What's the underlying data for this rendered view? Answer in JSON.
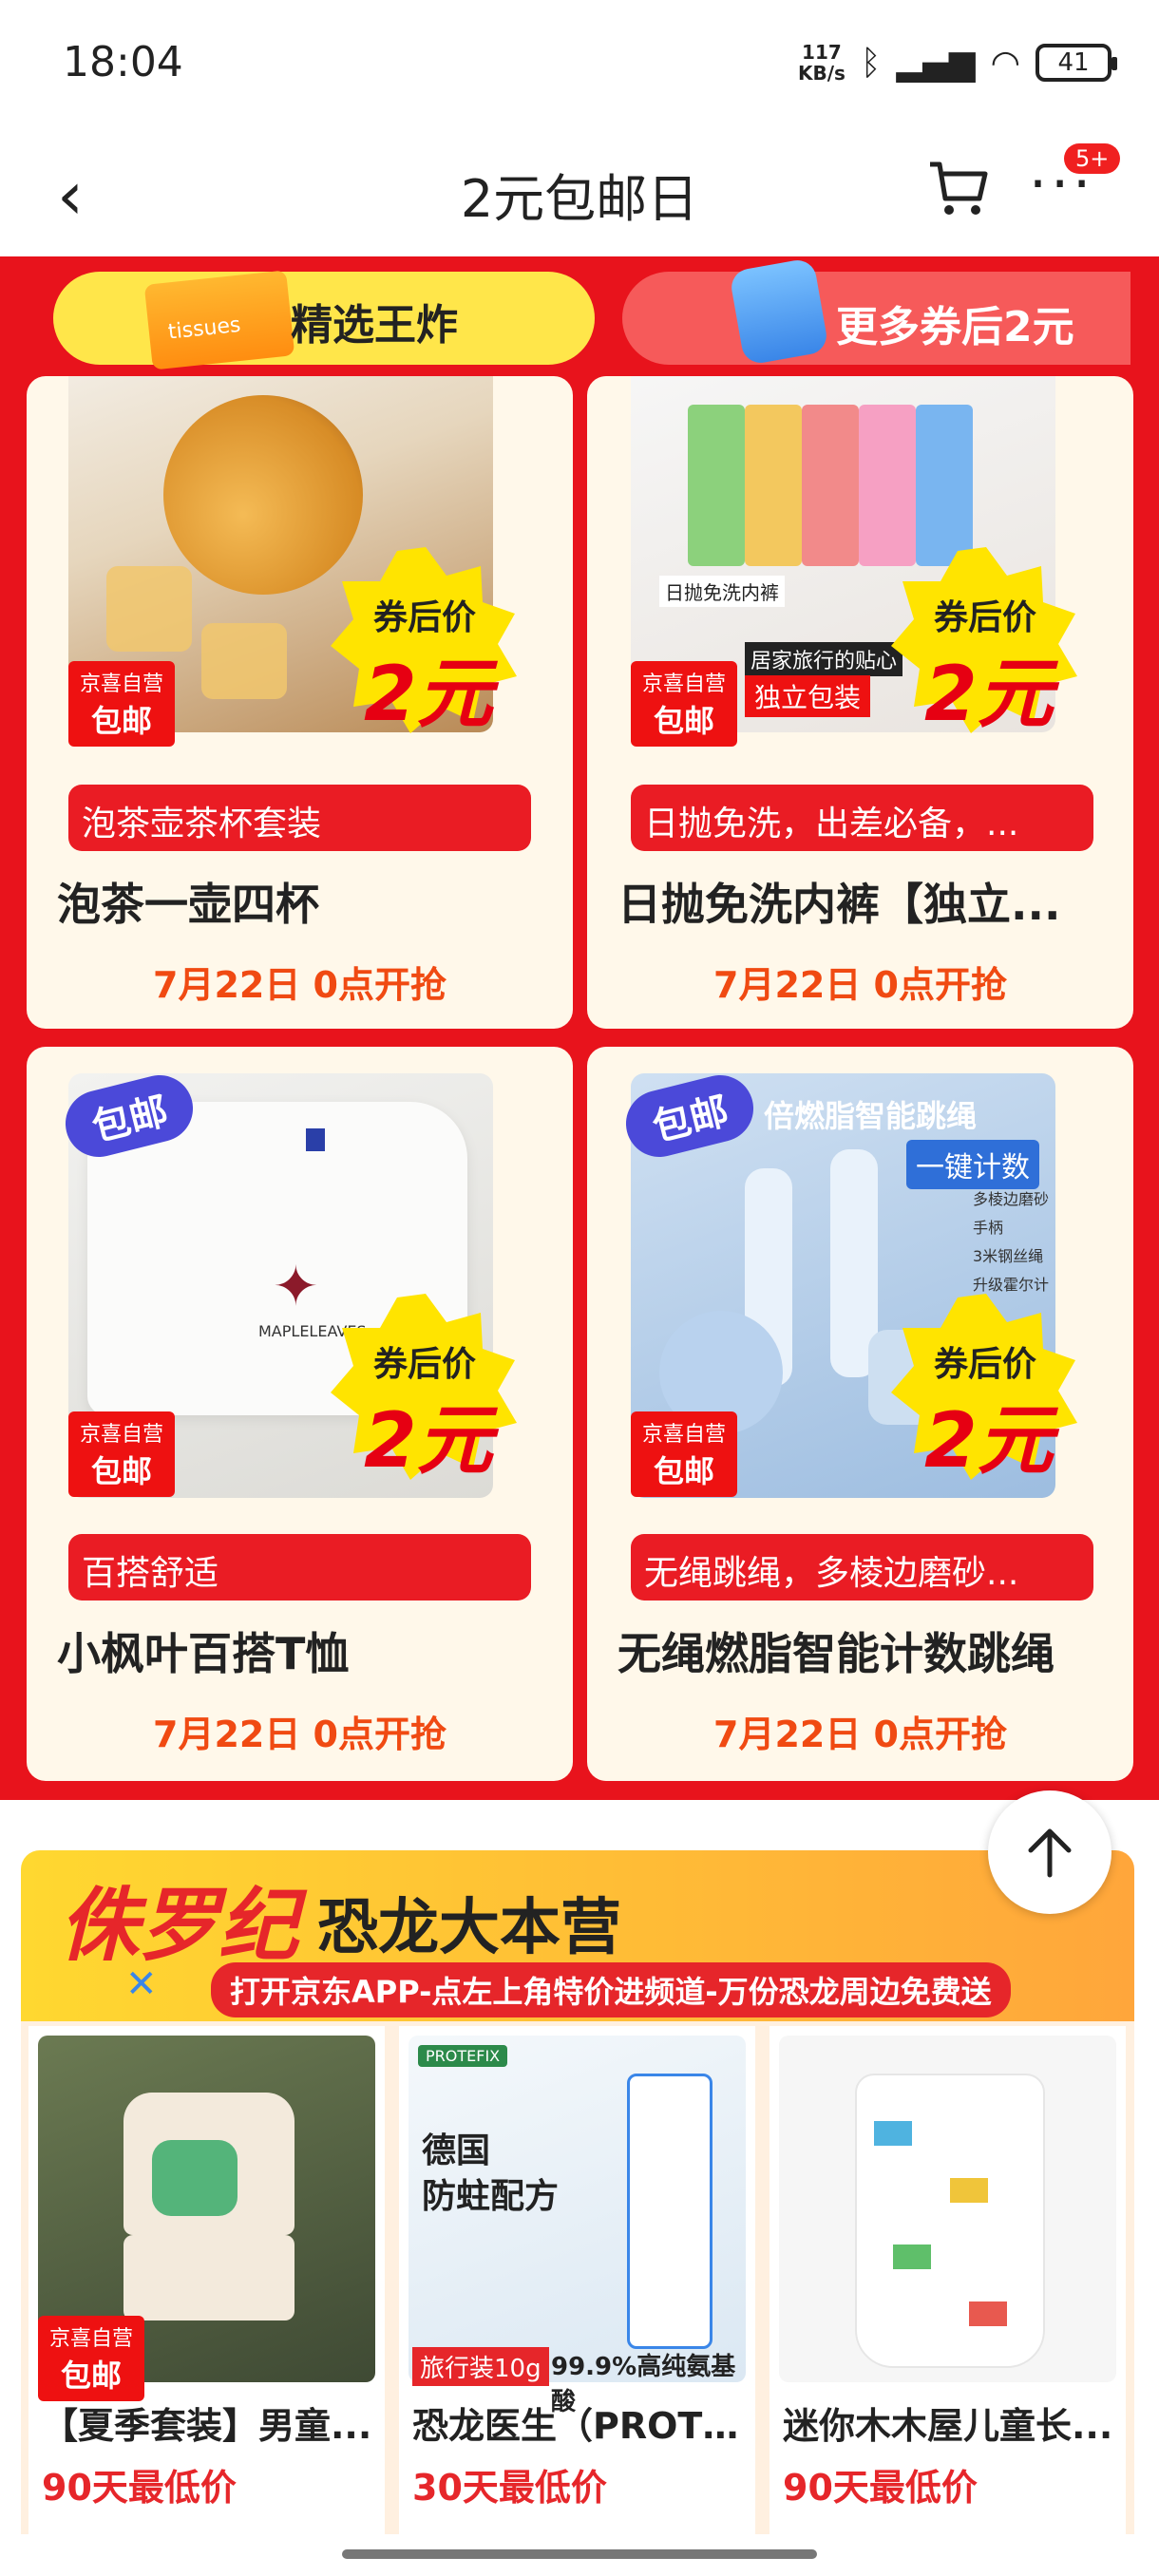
{
  "status": {
    "time": "18:04",
    "speed": "117",
    "speed_unit": "KB/s",
    "battery": "41"
  },
  "header": {
    "title": "2元包邮日",
    "badge": "5+"
  },
  "tabs": {
    "left": "精选王炸",
    "left_icon_text": "tissues",
    "right": "更多券后2元"
  },
  "coupon": {
    "label": "券后价",
    "price": "2元"
  },
  "pkg": {
    "top": "京喜自营",
    "bottom": "包邮"
  },
  "baoyou": "包邮",
  "products": [
    {
      "img_caption": "",
      "tag": "泡茶壶茶杯套装",
      "name": "泡茶一壶四杯",
      "time": "7月22日 0点开抢"
    },
    {
      "img_caption": "日抛免洗内裤",
      "tag": "日抛免洗，出差必备，...",
      "name": "日抛免洗内裤【独立...",
      "time": "7月22日 0点开抢"
    },
    {
      "img_caption": "MAPLELEAVES",
      "tag": "百搭舒适",
      "name": "小枫叶百搭T恤",
      "time": "7月22日 0点开抢"
    },
    {
      "img_caption": "倍燃脂智能跳绳",
      "tag": "无绳跳绳，多棱边磨砂...",
      "name": "无绳燃脂智能计数跳绳",
      "time": "7月22日 0点开抢"
    }
  ],
  "card2": {
    "label1": "居家旅行的贴心",
    "label2": "独立包装"
  },
  "card4": {
    "label1": "一键计数",
    "labels": [
      "多棱边磨砂手柄",
      "3米钢丝绳",
      "升级霍尔计数"
    ]
  },
  "dino": {
    "title1": "侏罗纪",
    "title2": "恐龙大本营",
    "subtitle": "打开京东APP-点左上角特价进频道-万份恐龙周边免费送",
    "items": [
      {
        "name": "【夏季套装】男童...",
        "price": "90天最低价"
      },
      {
        "name": "恐龙医生（PROTE...",
        "price": "30天最低价",
        "badge1": "旅行装10g",
        "badge2": "99.9%高纯氨基酸",
        "brand": "PROTEFIX",
        "line1": "德国",
        "line2": "防蛀配方"
      },
      {
        "name": "迷你木木屋儿童长...",
        "price": "90天最低价"
      }
    ]
  },
  "colors": {
    "accent": "#e8131c",
    "price": "#f04a12",
    "yellow": "#ffe64a"
  }
}
